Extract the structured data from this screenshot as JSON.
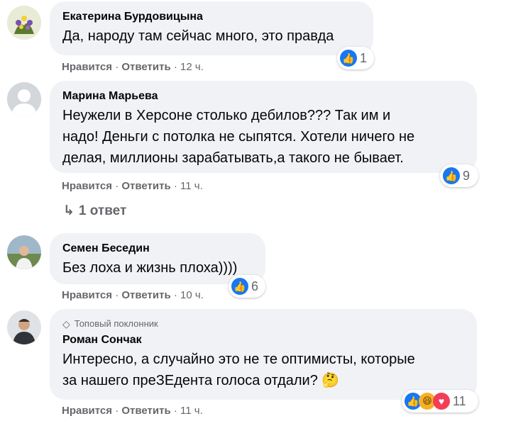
{
  "actions": {
    "like": "Нравится",
    "reply": "Ответить",
    "sep": "·"
  },
  "comments": [
    {
      "author": "Екатерина Бурдовицына",
      "lines": [
        "Да, народу там сейчас много, это правда"
      ],
      "time": "12 ч.",
      "reactions": [
        "like"
      ],
      "reaction_count": "1"
    },
    {
      "author": "Марина Марьева",
      "lines": [
        "Неужели в Херсоне столько дебилов??? Так им и",
        "надо! Деньги с потолка не сыпятся. Хотели ничего не",
        "делая, миллионы зарабатывать,а такого не бывает."
      ],
      "time": "11 ч.",
      "reactions": [
        "like"
      ],
      "reaction_count": "9",
      "replies_label": "1 ответ"
    },
    {
      "author": "Семен Беседин",
      "lines": [
        "Без лоха и жизнь плоха))))"
      ],
      "time": "10 ч.",
      "reactions": [
        "like"
      ],
      "reaction_count": "6"
    },
    {
      "badge": "Топовый поклонник",
      "author": "Роман Сончак",
      "lines": [
        "Интересно, а случайно это не те оптимисты, которые",
        "за нашего преЗЕдента голоса отдали? 🤔"
      ],
      "time": "11 ч.",
      "reactions": [
        "like",
        "haha",
        "love"
      ],
      "reaction_count": "11"
    }
  ],
  "colors": {
    "like": "#1877f2",
    "haha": "#f7b125",
    "love": "#f33e58",
    "bubble": "#f0f2f5",
    "meta": "#65676b"
  }
}
